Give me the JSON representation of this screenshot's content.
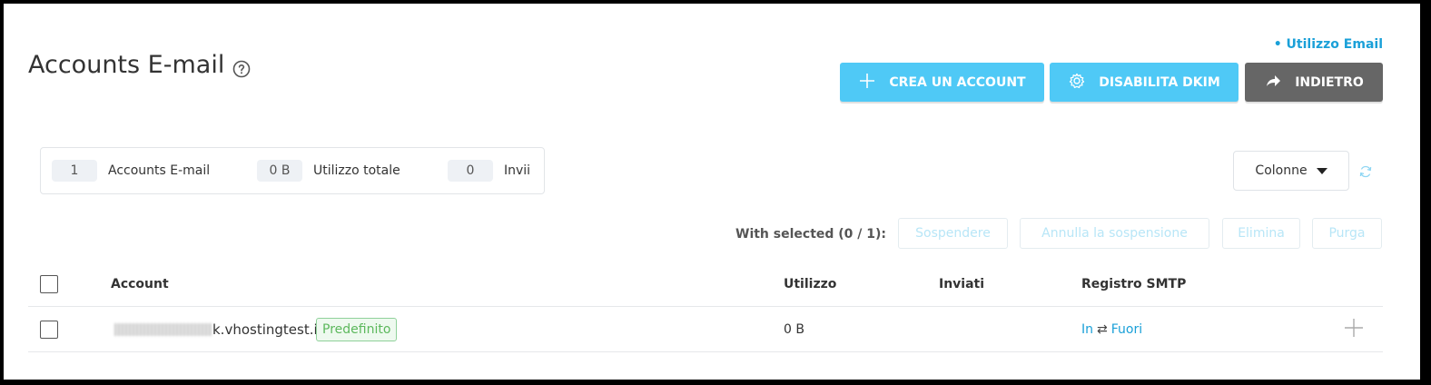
{
  "header": {
    "title": "Accounts E-mail",
    "usage_link": "• Utilizzo Email",
    "buttons": {
      "create": "CREA UN ACCOUNT",
      "dkim": "DISABILITA DKIM",
      "back": "INDIETRO"
    }
  },
  "stats": [
    {
      "value": "1",
      "label": "Accounts E-mail"
    },
    {
      "value": "0 B",
      "label": "Utilizzo totale"
    },
    {
      "value": "0",
      "label": "Invii"
    }
  ],
  "columns_button": "Colonne",
  "bulk": {
    "label": "With selected (0 / 1):",
    "actions": [
      "Sospendere",
      "Annulla la sospensione",
      "Elimina",
      "Purga"
    ]
  },
  "table": {
    "headers": {
      "account": "Account",
      "usage": "Utilizzo",
      "sent": "Inviati",
      "smtp": "Registro SMTP"
    },
    "rows": [
      {
        "account_suffix": "k.vhostingtest.it",
        "badge": "Predefinito",
        "usage": "0 B",
        "sent": "",
        "smtp_in": "In",
        "smtp_sep": "⇄",
        "smtp_out": "Fuori"
      }
    ]
  },
  "colors": {
    "accent_blue": "#4fc9f6",
    "link_blue": "#1aa0d8",
    "dark_button": "#666666",
    "badge_green": "#5cb85c"
  },
  "icons": {
    "help": "question-circle-icon",
    "create": "plus-icon",
    "dkim": "gear-icon",
    "back": "share-arrow-icon",
    "columns": "caret-down-icon",
    "refresh": "refresh-icon",
    "row_action": "plus-icon"
  }
}
